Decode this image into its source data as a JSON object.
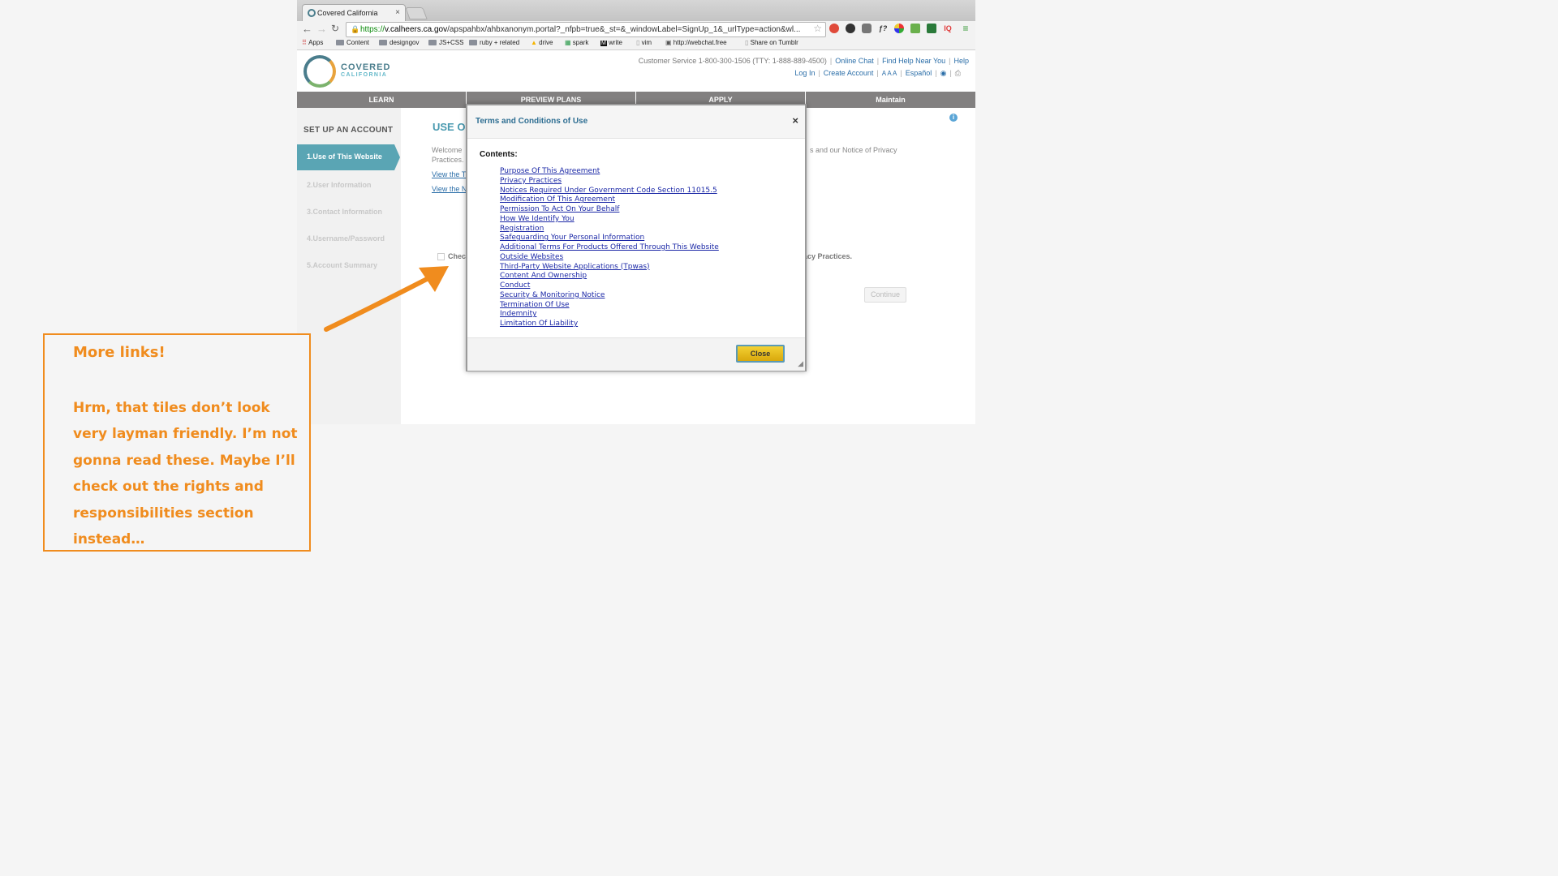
{
  "browser": {
    "tab_title": "Covered California",
    "tab_close": "×",
    "url_scheme": "https://",
    "url_host": "v.calheers.ca.gov",
    "url_path": "/apspahbx/ahbxanonym.portal?_nfpb=true&_st=&_windowLabel=SignUp_1&_urlType=action&wl...",
    "bookmarks": [
      "Apps",
      "Content",
      "designgov",
      "JS+CSS",
      "ruby + related",
      "drive",
      "spark",
      "write",
      "vim",
      "http://webchat.free",
      "Share on Tumblr"
    ],
    "extension_labels": [
      "ƒ?",
      "IQ"
    ]
  },
  "header": {
    "logo_title": "COVERED",
    "logo_subtitle": "CALIFORNIA",
    "customer_service": "Customer Service 1-800-300-1506 (TTY: 1-888-889-4500)",
    "online_chat": "Online Chat",
    "find_help": "Find Help Near You",
    "help": "Help",
    "log_in": "Log In",
    "create_account": "Create Account",
    "text_size": "A A A",
    "espanol": "Español"
  },
  "nav": [
    "LEARN",
    "PREVIEW PLANS",
    "APPLY",
    "Maintain"
  ],
  "sidebar": {
    "title": "SET UP AN ACCOUNT",
    "steps": [
      "1.Use of This Website",
      "2.User Information",
      "3.Contact Information",
      "4.Username/Password",
      "5.Account Summary"
    ]
  },
  "content": {
    "title": "USE O",
    "welcome": "Welcome",
    "practices": "Practices.",
    "privacy_tail": "s and our Notice of Privacy",
    "view_terms": "View the T",
    "view_notice": "View the N",
    "checkbox_label": "Chec",
    "checkbox_tail": "acy Practices.",
    "continue": "Continue"
  },
  "modal": {
    "title": "Terms and Conditions of Use",
    "close_x": "×",
    "contents_label": "Contents:",
    "toc": [
      "Purpose Of This Agreement",
      "Privacy Practices",
      "Notices Required Under Government Code Section 11015.5",
      "Modification Of This Agreement",
      "Permission To Act On Your Behalf",
      "How We Identify You",
      "Registration",
      "Safeguarding Your Personal Information",
      "Additional Terms For Products Offered Through This Website",
      "Outside Websites",
      "Third-Party Website Applications (Tpwas)",
      "Content And Ownership",
      "Conduct",
      "Security & Monitoring Notice",
      "Termination Of Use",
      "Indemnity",
      "Limitation Of Liability"
    ],
    "close_button": "Close"
  },
  "annotation": {
    "title": "More links!",
    "body": "Hrm, that tiles don’t look very layman friendly. I’m not gonna read these. Maybe I’ll check out the rights and responsibilities section instead…"
  },
  "colors": {
    "accent_teal": "#5aa5b4",
    "nav_gray": "#828080",
    "annotation_orange": "#f08c1e",
    "close_button_yellow": "#f3d133",
    "link_blue": "#1a27a6"
  }
}
